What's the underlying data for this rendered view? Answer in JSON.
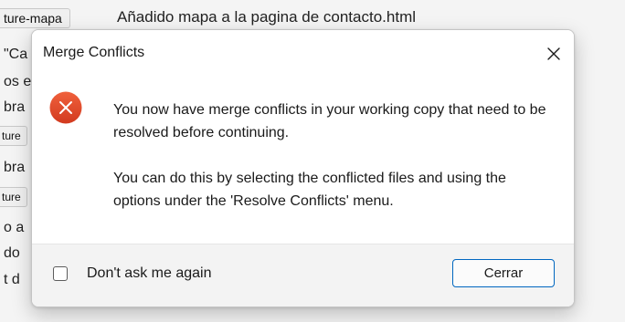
{
  "background": {
    "rows": [
      {
        "tag": "ture-mapa",
        "text": "Añadido mapa a la pagina de contacto.html"
      },
      {
        "tag": "",
        "text": "\"Ca"
      },
      {
        "tag": "",
        "text": "os e"
      },
      {
        "tag": "",
        "text": "bra"
      },
      {
        "tag": "ture",
        "text": ""
      },
      {
        "tag": "",
        "text": "bra"
      },
      {
        "tag": "ture",
        "text": ""
      },
      {
        "tag": "",
        "text": "o a"
      },
      {
        "tag": "",
        "text": "do"
      },
      {
        "tag": "",
        "text": "t d"
      }
    ]
  },
  "dialog": {
    "title": "Merge Conflicts",
    "close_icon": "close-icon",
    "icon": "error-icon",
    "error_color": "#e0442a",
    "accent_color": "#0067c0",
    "message_line1": "You now have merge conflicts in your working copy that need to be resolved before continuing.",
    "message_line2": "You can do this by selecting the conflicted files and using the options under the 'Resolve Conflicts' menu.",
    "checkbox_label": "Don't ask me again",
    "checkbox_checked": false,
    "button_label": "Cerrar"
  }
}
